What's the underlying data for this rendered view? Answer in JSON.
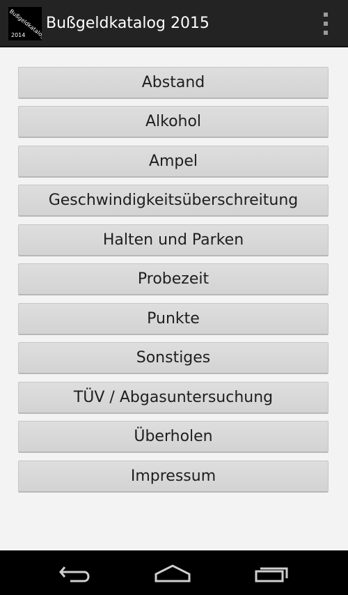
{
  "action_bar": {
    "title": "Bußgeldkatalog 2015",
    "icon_text_diagonal": "Bußgeldkatalog",
    "icon_text_year": "2014"
  },
  "menu": {
    "items": [
      {
        "label": "Abstand"
      },
      {
        "label": "Alkohol"
      },
      {
        "label": "Ampel"
      },
      {
        "label": "Geschwindigkeitsüberschreitung"
      },
      {
        "label": "Halten und Parken"
      },
      {
        "label": "Probezeit"
      },
      {
        "label": "Punkte"
      },
      {
        "label": "Sonstiges"
      },
      {
        "label": "TÜV / Abgasuntersuchung"
      },
      {
        "label": "Überholen"
      },
      {
        "label": "Impressum"
      }
    ]
  },
  "nav_bar": {
    "icons": [
      "back-icon",
      "home-icon",
      "recent-apps-icon"
    ]
  },
  "colors": {
    "action_bar": "#232323",
    "background": "#f3f3f3",
    "button": "#d9d9d9",
    "nav_bar": "#000000"
  }
}
